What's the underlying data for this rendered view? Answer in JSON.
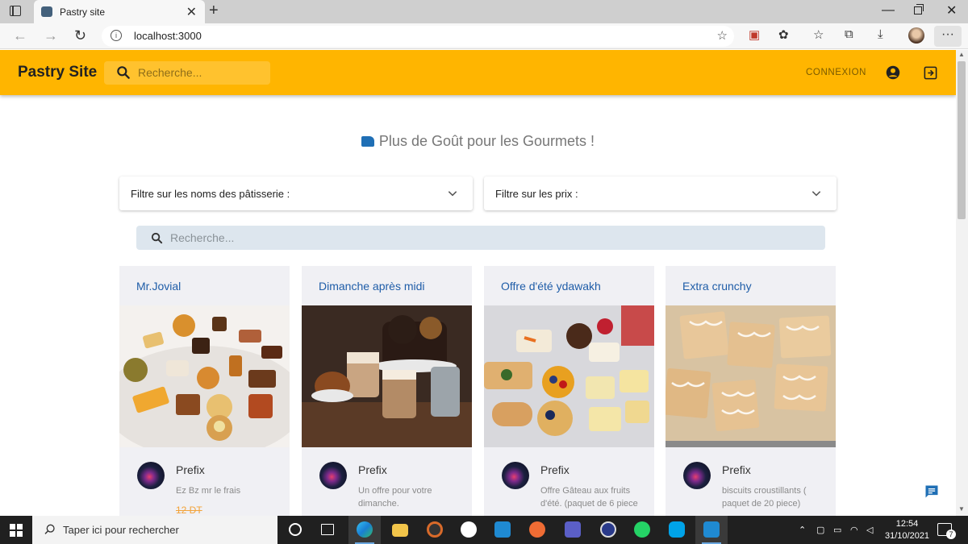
{
  "browser": {
    "tab_title": "Pastry site",
    "url": "localhost:3000"
  },
  "appbar": {
    "brand": "Pastry Site",
    "search_placeholder": "Recherche...",
    "login_label": "CONNEXION"
  },
  "tagline": "Plus de Goût pour les Gourmets !",
  "filters": [
    {
      "label": "Filtre sur les noms des pâtisserie :"
    },
    {
      "label": "Filtre sur les prix :"
    }
  ],
  "main_search": {
    "placeholder": "Recherche..."
  },
  "cards": [
    {
      "title": "Mr.Jovial",
      "author": "Prefix",
      "description": "Ez Bz mr le frais",
      "price": "12 DT"
    },
    {
      "title": "Dimanche après midi",
      "author": "Prefix",
      "description": "Un offre pour votre dimanche.",
      "price": ""
    },
    {
      "title": "Offre d'été ydawakh",
      "author": "Prefix",
      "description": "Offre Gâteau aux fruits d'été. (paquet de 6 piece",
      "price": ""
    },
    {
      "title": "Extra crunchy",
      "author": "Prefix",
      "description": "biscuits croustillants ( paquet de 20 piece)",
      "price": ""
    }
  ],
  "taskbar": {
    "search_placeholder": "Taper ici pour rechercher",
    "time": "12:54",
    "date": "31/10/2021",
    "notification_count": "7"
  },
  "colors": {
    "appbar": "#ffb500",
    "card_title": "#1f5da8",
    "price": "#f2a33a"
  }
}
